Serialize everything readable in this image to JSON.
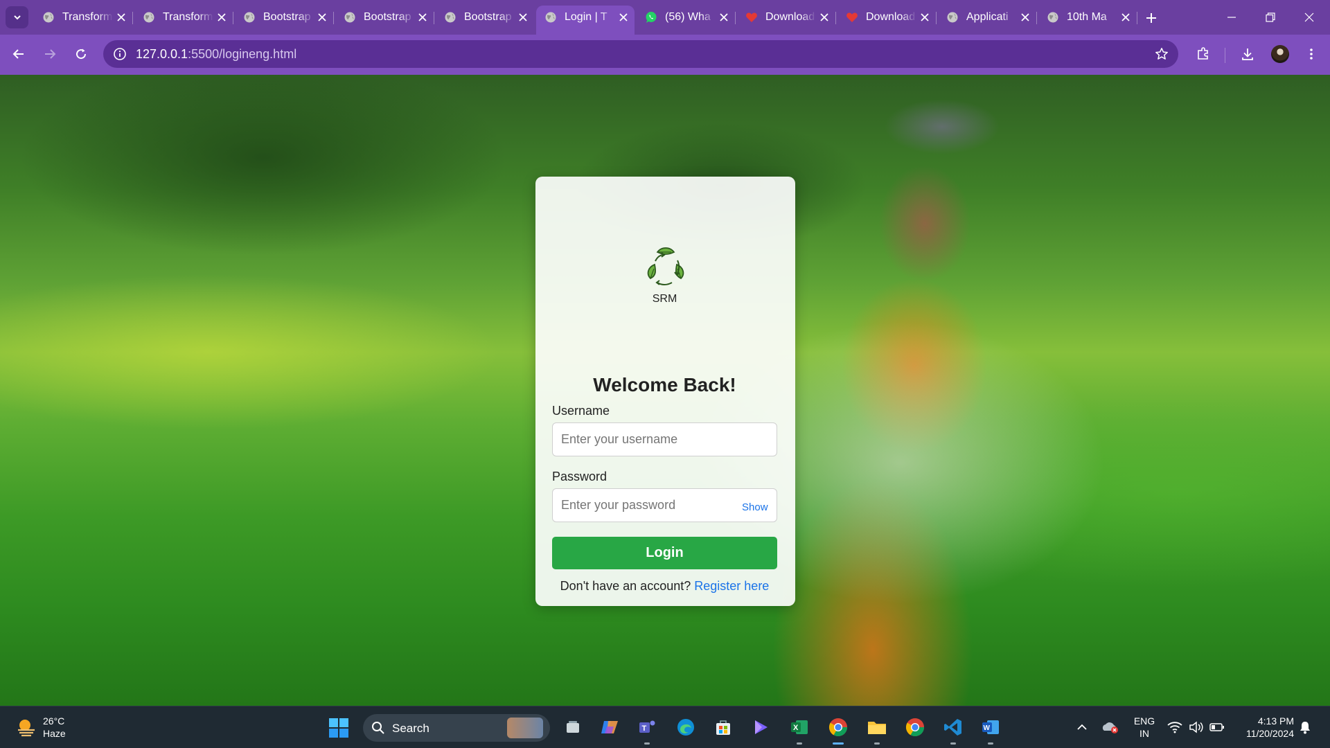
{
  "browser": {
    "tabs": [
      {
        "title": "Transform",
        "icon": "globe-icon",
        "active": false
      },
      {
        "title": "Transform",
        "icon": "globe-icon",
        "active": false
      },
      {
        "title": "Bootstrap",
        "icon": "globe-icon",
        "active": false
      },
      {
        "title": "Bootstrap",
        "icon": "globe-icon",
        "active": false
      },
      {
        "title": "Bootstrap",
        "icon": "globe-icon",
        "active": false
      },
      {
        "title": "Login | T",
        "icon": "globe-icon",
        "active": true
      },
      {
        "title": "(56) Wha",
        "icon": "whatsapp-icon",
        "active": false
      },
      {
        "title": "Download",
        "icon": "heart-icon",
        "active": false
      },
      {
        "title": "Download",
        "icon": "heart-icon",
        "active": false
      },
      {
        "title": "Applicati",
        "icon": "globe-icon",
        "active": false
      },
      {
        "title": "10th Ma",
        "icon": "globe-icon",
        "active": false
      }
    ],
    "url_host": "127.0.0.1",
    "url_path": ":5500/logineng.html"
  },
  "login": {
    "brand": "SRM",
    "heading": "Welcome Back!",
    "username_label": "Username",
    "username_placeholder": "Enter your username",
    "password_label": "Password",
    "password_placeholder": "Enter your password",
    "show_label": "Show",
    "login_button": "Login",
    "register_prompt": "Don't have an account?",
    "register_link": "Register here"
  },
  "taskbar": {
    "weather_temp": "26°C",
    "weather_desc": "Haze",
    "search_label": "Search",
    "language_line1": "ENG",
    "language_line2": "IN",
    "time": "4:13 PM",
    "date": "11/20/2024"
  },
  "colors": {
    "chrome_purple": "#7e4fbe",
    "tabbar_purple": "#6a3fa0",
    "login_green": "#28a745",
    "link_blue": "#1a73e8",
    "taskbar_bg": "#1f2a33"
  }
}
